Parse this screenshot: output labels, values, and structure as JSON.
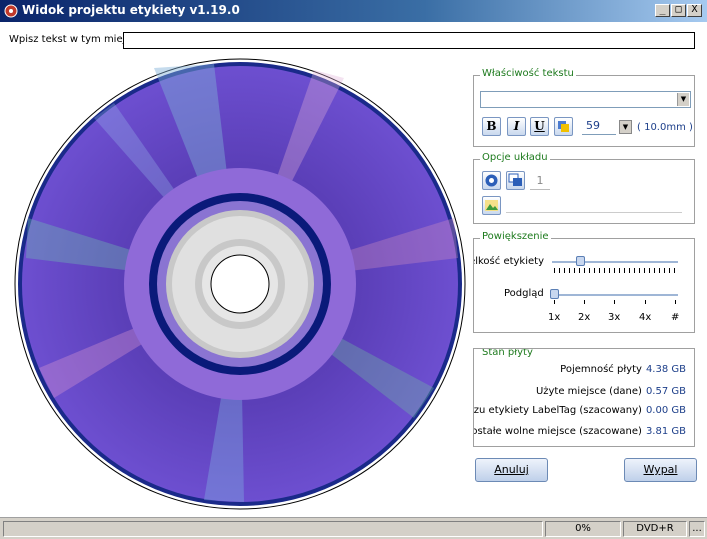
{
  "window": {
    "title": "Widok projektu etykiety v1.19.0",
    "minimize": "_",
    "maximize": "□",
    "close": "X"
  },
  "text_input": {
    "label": "Wpisz tekst w tym miejscu",
    "value": ""
  },
  "text_properties": {
    "title": "Właściwość tekstu",
    "font_value": "",
    "bold": "B",
    "italic": "I",
    "underline": "U",
    "font_size": "59",
    "size_mm": "( 10.0mm )"
  },
  "layout_options": {
    "title": "Opcje układu",
    "count_value": "1"
  },
  "zoom": {
    "title": "Powiększenie",
    "label_size": "Wielkość etykiety",
    "preview": "Podgląd",
    "label_size_level": 0.2,
    "preview_level": 0.0,
    "ticks": [
      "1x",
      "2x",
      "3x",
      "4x",
      "#"
    ]
  },
  "disc_status": {
    "title": "Stan płyty",
    "rows": [
      {
        "label": "Pojemność płyty",
        "value": "4.38 GB"
      },
      {
        "label": "Użyte miejsce (dane)",
        "value": "0.57 GB"
      },
      {
        "label": "Rozmiar obrazu etykiety LabelTag (szacowany)",
        "value": "0.00 GB"
      },
      {
        "label": "Pozostałe wolne miejsce (szacowane)",
        "value": "3.81 GB"
      }
    ]
  },
  "buttons": {
    "cancel": "Anuluj",
    "burn": "Wypal"
  },
  "status_bar": {
    "progress": "0%",
    "media": "DVD+R",
    "extra": "..."
  },
  "colors": {
    "disc_purple": "#6a48c8",
    "hub_ring": "#0a1a7a",
    "legend_green": "#1d7a1d"
  }
}
